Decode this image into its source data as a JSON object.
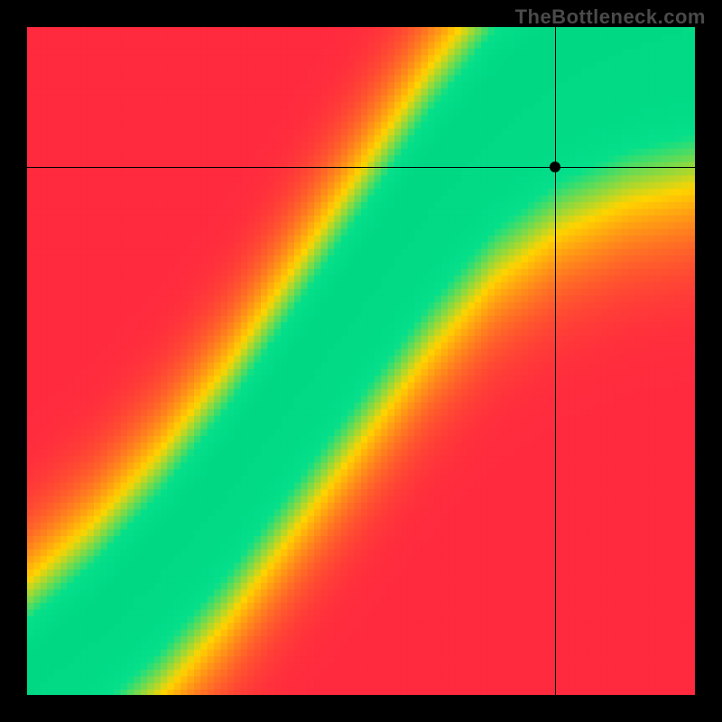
{
  "watermark": "TheBottleneck.com",
  "chart_data": {
    "type": "heatmap",
    "title": "",
    "xlabel": "",
    "ylabel": "",
    "xlim": [
      0,
      1
    ],
    "ylim": [
      0,
      1
    ],
    "grid": false,
    "legend": false,
    "color_scale": {
      "stops": [
        {
          "t": 0.0,
          "color": "#ff2a3f"
        },
        {
          "t": 0.45,
          "color": "#ffd400"
        },
        {
          "t": 0.78,
          "color": "#06e08b"
        },
        {
          "t": 1.0,
          "color": "#00d884"
        }
      ],
      "description": "red (poor match) → yellow → green (ideal match)"
    },
    "ridge": {
      "description": "locus of optimal pairing (green band center), y as function of x",
      "points": [
        {
          "x": 0.0,
          "y": 0.0
        },
        {
          "x": 0.1,
          "y": 0.08
        },
        {
          "x": 0.2,
          "y": 0.18
        },
        {
          "x": 0.3,
          "y": 0.3
        },
        {
          "x": 0.4,
          "y": 0.44
        },
        {
          "x": 0.5,
          "y": 0.58
        },
        {
          "x": 0.6,
          "y": 0.72
        },
        {
          "x": 0.7,
          "y": 0.84
        },
        {
          "x": 0.8,
          "y": 0.92
        },
        {
          "x": 0.9,
          "y": 0.97
        },
        {
          "x": 1.0,
          "y": 1.0
        }
      ],
      "band_halfwidth_y": 0.055
    },
    "marker": {
      "x": 0.79,
      "y": 0.79
    },
    "crosshair": {
      "x": 0.79,
      "y": 0.79
    },
    "resolution": 100
  }
}
